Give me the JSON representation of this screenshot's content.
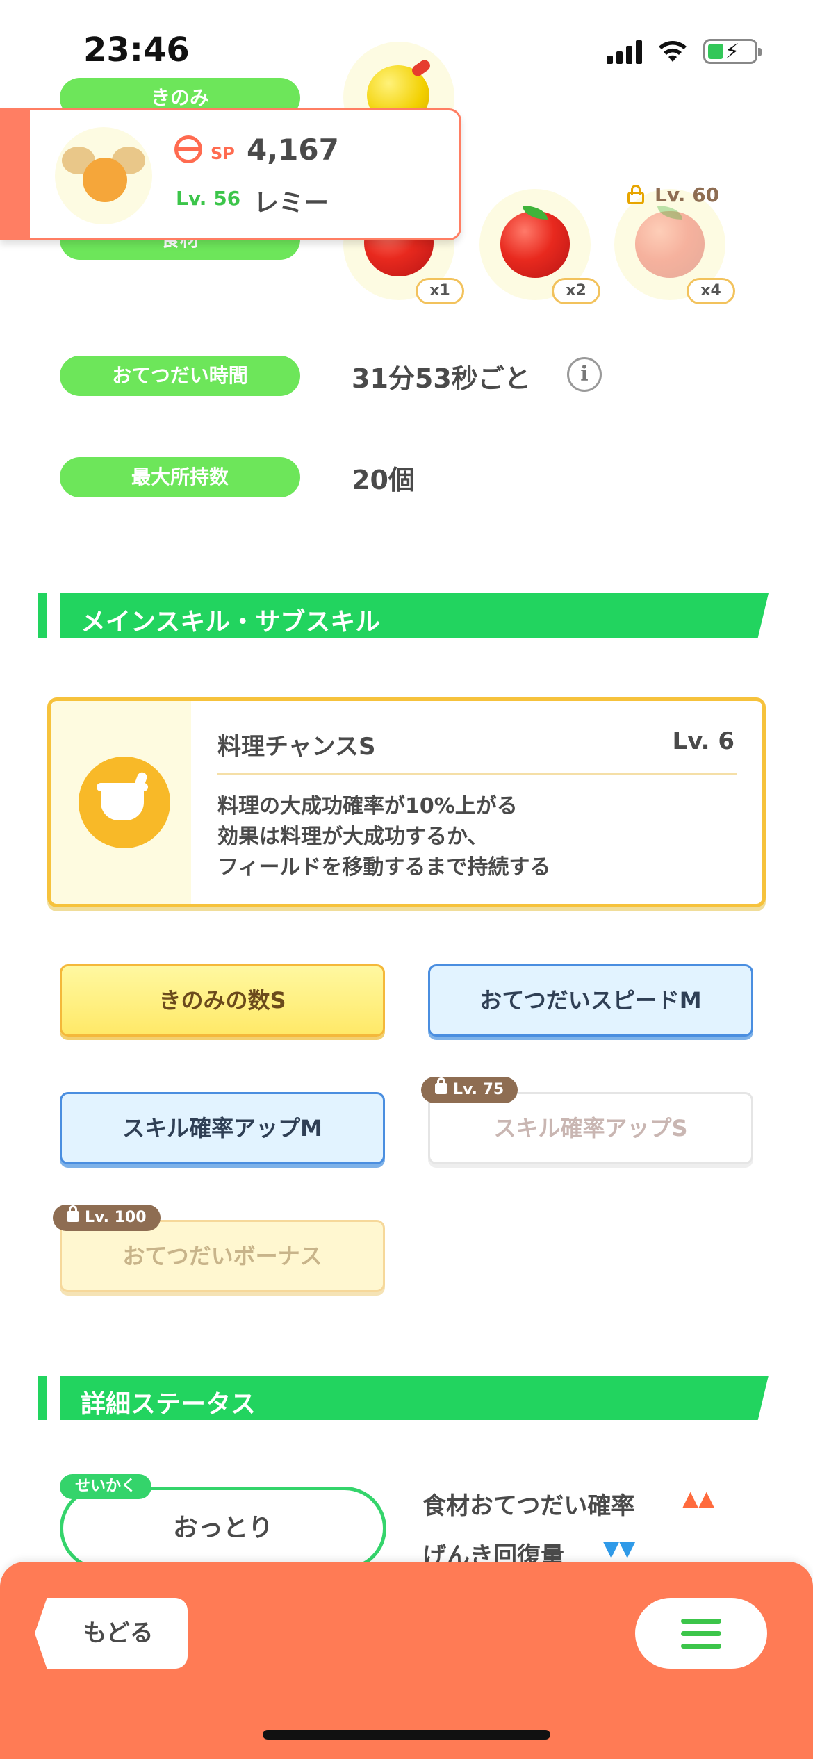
{
  "status_bar": {
    "time": "23:46"
  },
  "top_rows": {
    "berry_label": "きのみ",
    "ingredient_label": "食材",
    "ingredients": [
      {
        "qty": "x1",
        "locked": false
      },
      {
        "qty": "x2",
        "locked": false
      },
      {
        "qty": "x4",
        "locked": true,
        "unlock_level": "Lv. 60"
      }
    ]
  },
  "pokemon_card": {
    "sp_label": "SP",
    "sp_value": "4,167",
    "level": "Lv. 56",
    "name": "レミー"
  },
  "stats": {
    "help_time_label": "おてつだい時間",
    "help_time_value": "31分53秒ごと",
    "max_carry_label": "最大所持数",
    "max_carry_value": "20個"
  },
  "skills_section": {
    "title": "メインスキル・サブスキル",
    "main_skill": {
      "name": "料理チャンスS",
      "level": "Lv. 6",
      "description": [
        "料理の大成功確率が10%上がる",
        "効果は料理が大成功するか、",
        "フィールドを移動するまで持続する"
      ]
    },
    "sub_skills": [
      {
        "label": "きのみの数S",
        "style": "yellow",
        "locked": false
      },
      {
        "label": "おてつだいスピードM",
        "style": "blue",
        "locked": false
      },
      {
        "label": "スキル確率アップM",
        "style": "blue",
        "locked": false
      },
      {
        "label": "スキル確率アップS",
        "style": "locked-white",
        "locked": true,
        "unlock_level": "Lv. 75"
      },
      {
        "label": "おてつだいボーナス",
        "style": "locked-yellow",
        "locked": true,
        "unlock_level": "Lv. 100"
      }
    ]
  },
  "detail_section": {
    "title": "詳細ステータス",
    "nature_tag": "せいかく",
    "nature": "おっとり",
    "effects": [
      {
        "label": "食材おてつだい確率",
        "arrows": "▲▲",
        "color": "#ff6b3d"
      },
      {
        "label": "げんき回復量",
        "arrows": "▼▼",
        "color": "#2f9ae8"
      }
    ]
  },
  "bottom_bar": {
    "back_label": "もどる",
    "menu_icon": "hamburger-menu-icon"
  }
}
